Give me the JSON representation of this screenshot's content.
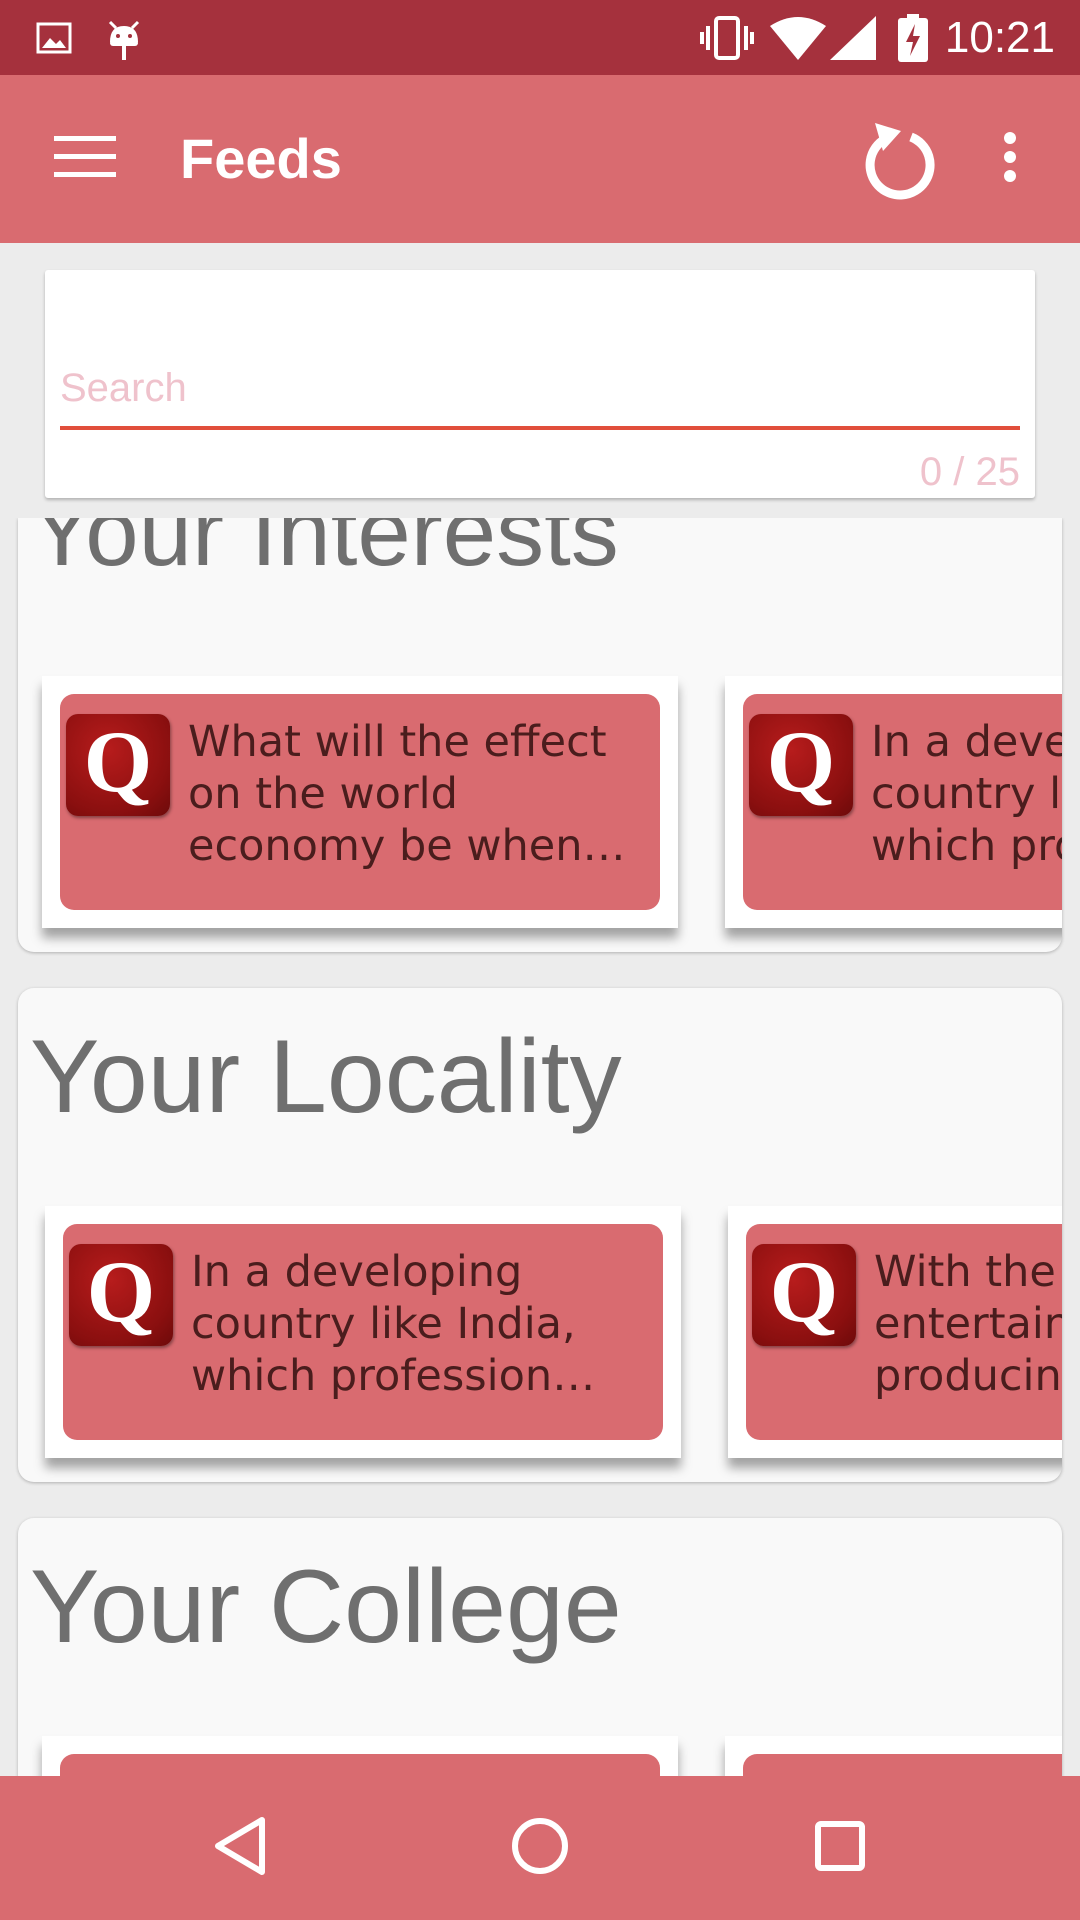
{
  "status_bar": {
    "time": "10:21",
    "icons": [
      "image-icon",
      "android-debug-icon",
      "vibrate-icon",
      "wifi-icon",
      "signal-icon",
      "battery-charging-icon"
    ]
  },
  "app_bar": {
    "title": "Feeds",
    "background": "#d96b70",
    "icons": [
      "menu-icon",
      "refresh-icon",
      "more-vert-icon"
    ]
  },
  "search": {
    "placeholder": "Search",
    "value": "",
    "counter": "0 / 25",
    "accent_color": "#e14e3b"
  },
  "sections": [
    {
      "title": "Your Interests",
      "cards": [
        {
          "icon": "quora-icon",
          "logo_letter": "Q",
          "text": "What will the effect on the world economy be when China finally…"
        },
        {
          "icon": "quora-icon",
          "logo_letter": "Q",
          "text": "In a developing country like India, which profession has…"
        }
      ]
    },
    {
      "title": "Your Locality",
      "cards": [
        {
          "icon": "quora-icon",
          "logo_letter": "Q",
          "text": "In a developing country like India, which profession has…"
        },
        {
          "icon": "quora-icon",
          "logo_letter": "Q",
          "text": "With the entertainment producing…"
        }
      ]
    },
    {
      "title": "Your College",
      "cards": []
    }
  ],
  "nav_bar": {
    "icons": [
      "back-icon",
      "home-icon",
      "recents-icon"
    ]
  }
}
